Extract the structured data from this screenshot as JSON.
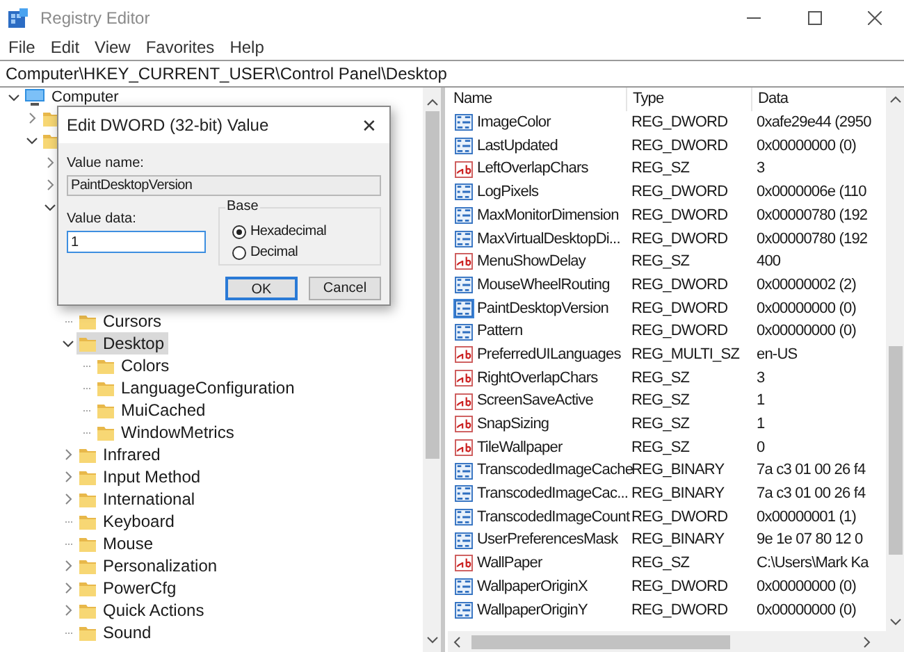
{
  "window": {
    "title": "Registry Editor"
  },
  "menu": [
    "File",
    "Edit",
    "View",
    "Favorites",
    "Help"
  ],
  "address": "Computer\\HKEY_CURRENT_USER\\Control Panel\\Desktop",
  "tree": [
    {
      "label": "Computer",
      "kind": "computer",
      "leaf": false,
      "expanded": true,
      "selected": false,
      "children": [
        {
          "leaf": false,
          "expanded": false
        },
        {
          "leaf": false,
          "expanded": true,
          "children": [
            {
              "leaf": false,
              "expanded": false
            },
            {
              "leaf": false,
              "expanded": false
            },
            {
              "leaf": false,
              "expanded": true,
              "children": [
                {
                  "label": "Cursors",
                  "leaf": true,
                  "selected": false
                },
                {
                  "label": "Desktop",
                  "leaf": false,
                  "expanded": true,
                  "selected": true,
                  "children": [
                    {
                      "label": "Colors",
                      "leaf": true,
                      "selected": false
                    },
                    {
                      "label": "LanguageConfiguration",
                      "leaf": true,
                      "selected": false
                    },
                    {
                      "label": "MuiCached",
                      "leaf": true,
                      "selected": false
                    },
                    {
                      "label": "WindowMetrics",
                      "leaf": true,
                      "selected": false
                    }
                  ]
                },
                {
                  "label": "Infrared",
                  "leaf": false,
                  "expanded": false,
                  "selected": false
                },
                {
                  "label": "Input Method",
                  "leaf": false,
                  "expanded": false,
                  "selected": false
                },
                {
                  "label": "International",
                  "leaf": false,
                  "expanded": false,
                  "selected": false
                },
                {
                  "label": "Keyboard",
                  "leaf": true,
                  "selected": false
                },
                {
                  "label": "Mouse",
                  "leaf": true,
                  "selected": false
                },
                {
                  "label": "Personalization",
                  "leaf": false,
                  "expanded": false,
                  "selected": false
                },
                {
                  "label": "PowerCfg",
                  "leaf": false,
                  "expanded": false,
                  "selected": false
                },
                {
                  "label": "Quick Actions",
                  "leaf": false,
                  "expanded": false,
                  "selected": false
                },
                {
                  "label": "Sound",
                  "leaf": true,
                  "selected": false
                }
              ]
            }
          ]
        }
      ]
    }
  ],
  "columns": [
    "Name",
    "Type",
    "Data"
  ],
  "values": [
    {
      "name": "ImageColor",
      "type": "REG_DWORD",
      "data": "0xafe29e44 (2950",
      "kind": "binary",
      "selected": false
    },
    {
      "name": "LastUpdated",
      "type": "REG_DWORD",
      "data": "0x00000000 (0)",
      "kind": "binary",
      "selected": false
    },
    {
      "name": "LeftOverlapChars",
      "type": "REG_SZ",
      "data": "3",
      "kind": "string",
      "selected": false
    },
    {
      "name": "LogPixels",
      "type": "REG_DWORD",
      "data": "0x0000006e (110",
      "kind": "binary",
      "selected": false
    },
    {
      "name": "MaxMonitorDimension",
      "type": "REG_DWORD",
      "data": "0x00000780 (192",
      "kind": "binary",
      "selected": false
    },
    {
      "name": "MaxVirtualDesktopDi...",
      "type": "REG_DWORD",
      "data": "0x00000780 (192",
      "kind": "binary",
      "selected": false
    },
    {
      "name": "MenuShowDelay",
      "type": "REG_SZ",
      "data": "400",
      "kind": "string",
      "selected": false
    },
    {
      "name": "MouseWheelRouting",
      "type": "REG_DWORD",
      "data": "0x00000002 (2)",
      "kind": "binary",
      "selected": false
    },
    {
      "name": "PaintDesktopVersion",
      "type": "REG_DWORD",
      "data": "0x00000000 (0)",
      "kind": "binary",
      "selected": true
    },
    {
      "name": "Pattern",
      "type": "REG_DWORD",
      "data": "0x00000000 (0)",
      "kind": "binary",
      "selected": false
    },
    {
      "name": "PreferredUILanguages",
      "type": "REG_MULTI_SZ",
      "data": "en-US",
      "kind": "string",
      "selected": false
    },
    {
      "name": "RightOverlapChars",
      "type": "REG_SZ",
      "data": "3",
      "kind": "string",
      "selected": false
    },
    {
      "name": "ScreenSaveActive",
      "type": "REG_SZ",
      "data": "1",
      "kind": "string",
      "selected": false
    },
    {
      "name": "SnapSizing",
      "type": "REG_SZ",
      "data": "1",
      "kind": "string",
      "selected": false
    },
    {
      "name": "TileWallpaper",
      "type": "REG_SZ",
      "data": "0",
      "kind": "string",
      "selected": false
    },
    {
      "name": "TranscodedImageCache",
      "type": "REG_BINARY",
      "data": "7a c3 01 00 26 f4",
      "kind": "binary",
      "selected": false
    },
    {
      "name": "TranscodedImageCac...",
      "type": "REG_BINARY",
      "data": "7a c3 01 00 26 f4",
      "kind": "binary",
      "selected": false
    },
    {
      "name": "TranscodedImageCount",
      "type": "REG_DWORD",
      "data": "0x00000001 (1)",
      "kind": "binary",
      "selected": false
    },
    {
      "name": "UserPreferencesMask",
      "type": "REG_BINARY",
      "data": "9e 1e 07 80 12 0",
      "kind": "binary",
      "selected": false
    },
    {
      "name": "WallPaper",
      "type": "REG_SZ",
      "data": "C:\\Users\\Mark Ka",
      "kind": "string",
      "selected": false
    },
    {
      "name": "WallpaperOriginX",
      "type": "REG_DWORD",
      "data": "0x00000000 (0)",
      "kind": "binary",
      "selected": false
    },
    {
      "name": "WallpaperOriginY",
      "type": "REG_DWORD",
      "data": "0x00000000 (0)",
      "kind": "binary",
      "selected": false
    }
  ],
  "dialog": {
    "title": "Edit DWORD (32-bit) Value",
    "close": "✕",
    "value_name_label": "Value name:",
    "value_name": "PaintDesktopVersion",
    "value_data_label": "Value data:",
    "value_data": "1",
    "base_label": "Base",
    "base_options": [
      {
        "label": "Hexadecimal",
        "selected": true
      },
      {
        "label": "Decimal",
        "selected": false
      }
    ],
    "buttons": [
      {
        "label": "OK",
        "default": true
      },
      {
        "label": "Cancel",
        "default": false
      }
    ]
  }
}
